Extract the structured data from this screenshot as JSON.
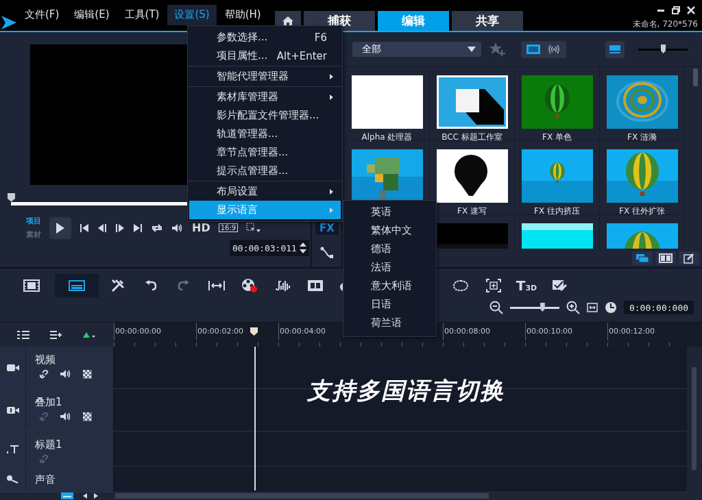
{
  "menu_bar": [
    {
      "label": "文件(F)",
      "selected": false
    },
    {
      "label": "编辑(E)",
      "selected": false
    },
    {
      "label": "工具(T)",
      "selected": false
    },
    {
      "label": "设置(S)",
      "selected": true
    },
    {
      "label": "帮助(H)",
      "selected": false
    }
  ],
  "mode_tabs": [
    {
      "label": "捕获",
      "selected": false
    },
    {
      "label": "编辑",
      "selected": true
    },
    {
      "label": "共享",
      "selected": false
    }
  ],
  "project_title": "未命名, 720*576",
  "player": {
    "scrubber": {
      "level": 0
    },
    "modes": [
      {
        "label": "项目",
        "selected": true
      },
      {
        "label": "素材",
        "selected": false
      }
    ],
    "quality": "HD",
    "aspect": "16:9",
    "timecode": "00:00:03:011"
  },
  "fx_label": "FX",
  "library": {
    "filter": "全部",
    "views": [
      {
        "selected": true
      },
      {
        "selected": false
      }
    ],
    "size_slider": {
      "level": 0.5
    },
    "items": [
      {
        "kind": "picture",
        "label": "Alpha 处理器"
      },
      {
        "kind": "picture",
        "label": "BCC 标题工作室"
      },
      {
        "kind": "picture",
        "label": "FX 单色"
      },
      {
        "kind": "picture",
        "label": "FX 涟漪"
      },
      {
        "kind": "picture"
      },
      {
        "kind": "picture",
        "label": "FX 速写"
      },
      {
        "kind": "picture",
        "label": "FX 往内挤压"
      },
      {
        "kind": "picture",
        "label": "FX 往外扩张"
      },
      {
        "kind": "picture"
      },
      {
        "kind": "picture"
      },
      {
        "kind": "picture"
      }
    ]
  },
  "timeline_toolbar": {
    "title3d": "T$_{3D}$",
    "zoom": {
      "level": 0.65
    },
    "timecode": "0:00:00:000"
  },
  "ruler": [
    "00:00:00:00",
    "00:00:02:00",
    "00:00:04:00",
    "00:00:08:00",
    "00:00:10:00",
    "00:00:12:00"
  ],
  "tracks": [
    {
      "kind": "video",
      "name": "视频"
    },
    {
      "kind": "overlay",
      "name": "叠加1"
    },
    {
      "kind": "title",
      "name": "标题1"
    },
    {
      "kind": "audio",
      "name": "声音"
    }
  ],
  "caption": "支持多国语言切换",
  "settings_menu": [
    [
      {
        "label": "参数选择...",
        "shortcut": "F6",
        "submenu": false,
        "selected": false
      },
      {
        "label": "项目属性...",
        "shortcut": "Alt+Enter",
        "submenu": false,
        "selected": false
      }
    ],
    [
      {
        "label": "智能代理管理器",
        "submenu": true,
        "selected": false
      }
    ],
    [
      {
        "label": "素材库管理器",
        "submenu": true,
        "selected": false
      },
      {
        "label": "影片配置文件管理器...",
        "submenu": false,
        "selected": false
      },
      {
        "label": "轨道管理器...",
        "submenu": false,
        "selected": false
      },
      {
        "label": "章节点管理器...",
        "submenu": false,
        "selected": false
      },
      {
        "label": "提示点管理器...",
        "submenu": false,
        "selected": false
      }
    ],
    [
      {
        "label": "布局设置",
        "submenu": true,
        "selected": false
      },
      {
        "label": "显示语言",
        "submenu": true,
        "selected": true
      }
    ]
  ],
  "language_menu": [
    "英语",
    "繁体中文",
    "德语",
    "法语",
    "意大利语",
    "日语",
    "荷兰语"
  ]
}
